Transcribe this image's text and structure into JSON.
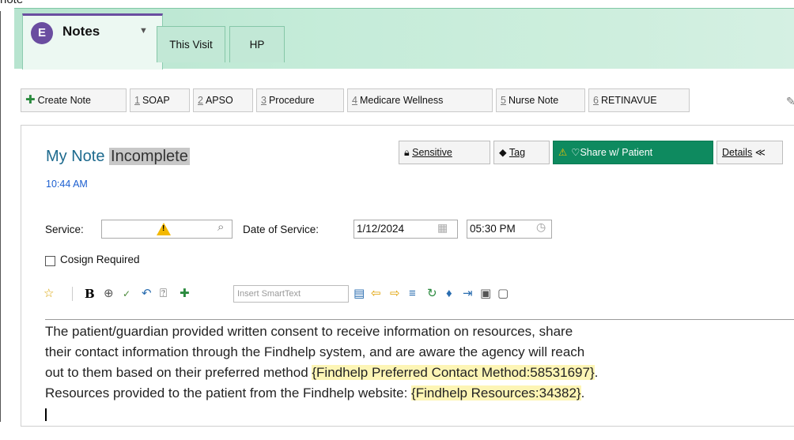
{
  "top_label": "note",
  "tabs": {
    "notes_icon": "E",
    "notes_label": "Notes",
    "this_visit": "This Visit",
    "hp": "HP"
  },
  "toolbar": {
    "create_note": "Create Note",
    "items": [
      {
        "num": "1",
        "label": "SOAP"
      },
      {
        "num": "2",
        "label": "APSO"
      },
      {
        "num": "3",
        "label": "Procedure"
      },
      {
        "num": "4",
        "label": "Medicare Wellness"
      },
      {
        "num": "5",
        "label": "Nurse Note"
      },
      {
        "num": "6",
        "label": "RETINAVUE"
      }
    ]
  },
  "note": {
    "title": "My Note",
    "status": "Incomplete",
    "time": "10:44 AM",
    "buttons": {
      "sensitive": "Sensitive",
      "tag": "Tag",
      "share": "Share w/ Patient",
      "details": "Details"
    }
  },
  "fields": {
    "service_label": "Service:",
    "service_value": "",
    "date_label": "Date of Service:",
    "date_value": "1/12/2024",
    "time_value": "05:30 PM",
    "cosign_label": "Cosign Required",
    "smarttext_placeholder": "Insert SmartText"
  },
  "body": {
    "line1": "The patient/guardian provided written consent to receive information on resources, share",
    "line2": "their contact information through the Findhelp system, and are aware the agency will reach",
    "line3_prefix": "out to them based on their preferred method ",
    "line3_link": "{Findhelp Preferred Contact Method:58531697}",
    "line3_suffix": ".",
    "line4_prefix": "Resources provided to the patient from the Findhelp website: ",
    "line4_link": "{Findhelp Resources:34382}",
    "line4_suffix": "."
  },
  "colors": {
    "accent_purple": "#6a4da0",
    "share_green": "#0e8a5f",
    "title_blue": "#1d6a8e",
    "smartlink_yellow": "#fdf5b5"
  }
}
